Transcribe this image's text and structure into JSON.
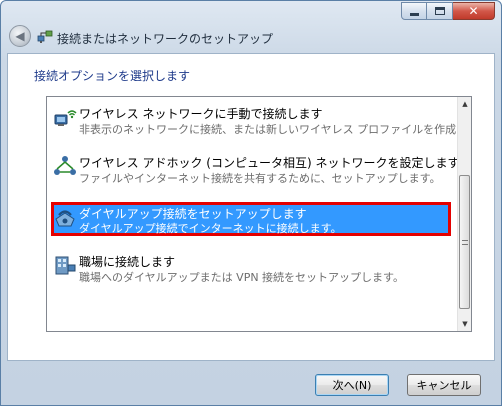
{
  "window": {
    "title": "接続またはネットワークのセットアップ",
    "close_glyph": "✕",
    "back_glyph": "◀"
  },
  "content": {
    "heading": "接続オプションを選択します"
  },
  "options": [
    {
      "title": "ワイヤレス ネットワークに手動で接続します",
      "description": "非表示のネットワークに接続、または新しいワイヤレス プロファイルを作成します。",
      "icon": "wireless-network-icon",
      "selected": false
    },
    {
      "title": "ワイヤレス アドホック (コンピュータ相互) ネットワークを設定します",
      "description": "ファイルやインターネット接続を共有するために、セットアップします。",
      "icon": "adhoc-network-icon",
      "selected": false
    },
    {
      "title": "ダイヤルアップ接続をセットアップします",
      "description": "ダイヤルアップ接続でインターネットに接続します。",
      "icon": "dialup-phone-icon",
      "selected": true
    },
    {
      "title": "職場に接続します",
      "description": "職場へのダイヤルアップまたは VPN 接続をセットアップします。",
      "icon": "workplace-icon",
      "selected": false
    }
  ],
  "scrollbar": {
    "up_glyph": "▲",
    "down_glyph": "▼"
  },
  "buttons": {
    "next": "次へ(N)",
    "cancel": "キャンセル"
  },
  "colors": {
    "selection": "#3399ff",
    "highlight_border": "#e40000",
    "heading": "#1e3a8a"
  }
}
